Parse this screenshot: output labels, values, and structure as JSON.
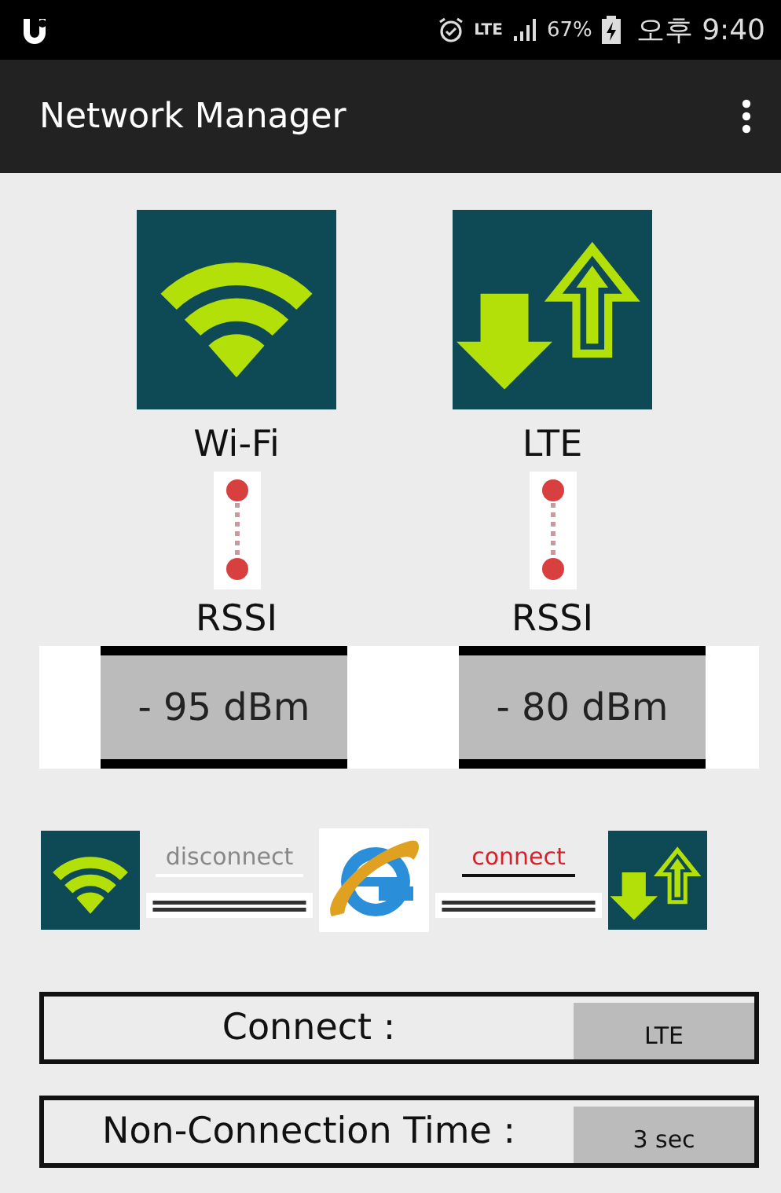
{
  "status_bar": {
    "network": "LTE",
    "battery": "67%",
    "time": "오후 9:40"
  },
  "app_bar": {
    "title": "Network Manager"
  },
  "networks": [
    {
      "kind": "wifi",
      "name": "Wi-Fi",
      "signal_label": "RSSI",
      "reading": "- 95 dBm"
    },
    {
      "kind": "lte",
      "name": "LTE",
      "signal_label": "RSSI",
      "reading": "- 80 dBm"
    }
  ],
  "links": [
    {
      "label": "disconnect",
      "connected": false
    },
    {
      "label": "connect",
      "connected": true
    }
  ],
  "info_rows": [
    {
      "label": "Connect :",
      "value": "LTE"
    },
    {
      "label": "Non-Connection Time :",
      "value": "3 sec"
    }
  ]
}
